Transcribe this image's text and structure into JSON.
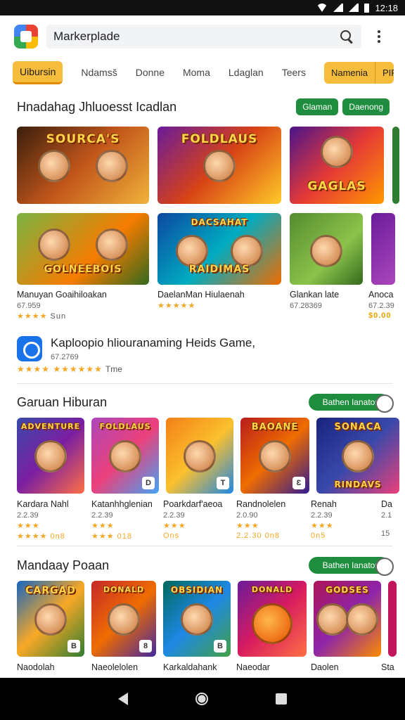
{
  "status_bar": {
    "time": "12:18"
  },
  "search": {
    "value": "Markerplade"
  },
  "tabs": {
    "items": [
      "Uibursin",
      "Ndamsš",
      "Donne",
      "Moma",
      "Ldaglan",
      "Teers"
    ],
    "group": [
      "Namenia",
      "PIP"
    ]
  },
  "section1": {
    "title": "Hnadahag Jhluoesst Icadlan",
    "chips": [
      "Glaman",
      "Daenong"
    ],
    "top_cards": [
      "SOURCA'S",
      "FOLDLAUS",
      "GAGLAS"
    ],
    "bottom_cards": [
      "GOLNEEBOIS",
      "RAIDIMAS",
      "",
      ""
    ],
    "bottom_top_art": [
      "",
      "DACSAHAT",
      "",
      ""
    ],
    "labels": [
      {
        "title": "Manuyan Goaihiloakan",
        "sub": "67.959",
        "stars": "★★★★",
        "extra": "Sun"
      },
      {
        "title": "DaelanMan Hiulaenah",
        "sub": "",
        "stars": "★★★★★",
        "extra": ""
      },
      {
        "title": "Glankan late",
        "sub": "67.28369",
        "stars": "",
        "extra": ""
      },
      {
        "title": "Anoca",
        "sub": "67.2.39",
        "stars": "",
        "extra": "$0.00"
      }
    ]
  },
  "featured": {
    "title": "Kaploopio hliouranaming Heids Game,",
    "sub": "67.2769",
    "stars": "★★★★ ★★★★★★",
    "extra": "Tme"
  },
  "section2": {
    "title": "Garuan Hiburan",
    "toggle": "Bathen   Ianaton",
    "cards": [
      "ADVENTURE",
      "FOLDLAUS",
      "",
      "BAOANE",
      "SONACA"
    ],
    "cards_bottom": [
      "",
      "",
      "",
      "",
      "RINDAVS"
    ],
    "labels": [
      {
        "title": "Kardara Nahl",
        "sub": "2.2.39",
        "stars": "★★★",
        "extra": "★★★★ 0n8"
      },
      {
        "title": "Katanhhglenian",
        "sub": "2.2.39",
        "stars": "★★★",
        "extra": "★★★ 018"
      },
      {
        "title": "Poarkdarf'aeoa",
        "sub": "2.2.39",
        "stars": "★★★",
        "extra": "Ons"
      },
      {
        "title": "Randnolelen",
        "sub": "2.0.90",
        "stars": "★★★",
        "extra": "2.2.30 0n8"
      },
      {
        "title": "Renah",
        "sub": "2.2.39",
        "stars": "★★★",
        "extra": "0n5"
      },
      {
        "title": "Da",
        "sub": "2.1",
        "stars": "",
        "extra": "15"
      }
    ]
  },
  "section3": {
    "title": "Mandaay Poaan",
    "toggle": "Bathen   Ianaton",
    "cards": [
      "CARGAD",
      "DONALD",
      "OBSIDIAN",
      "DONALD",
      "GODSES",
      ""
    ],
    "labels": [
      "Naodolah",
      "Naeolelolen",
      "Karkaldahank",
      "Naeodar",
      "Daolen",
      "Sta"
    ]
  },
  "navbar": {
    "back": "back-icon",
    "home": "home-icon",
    "recent": "recent-icon"
  }
}
